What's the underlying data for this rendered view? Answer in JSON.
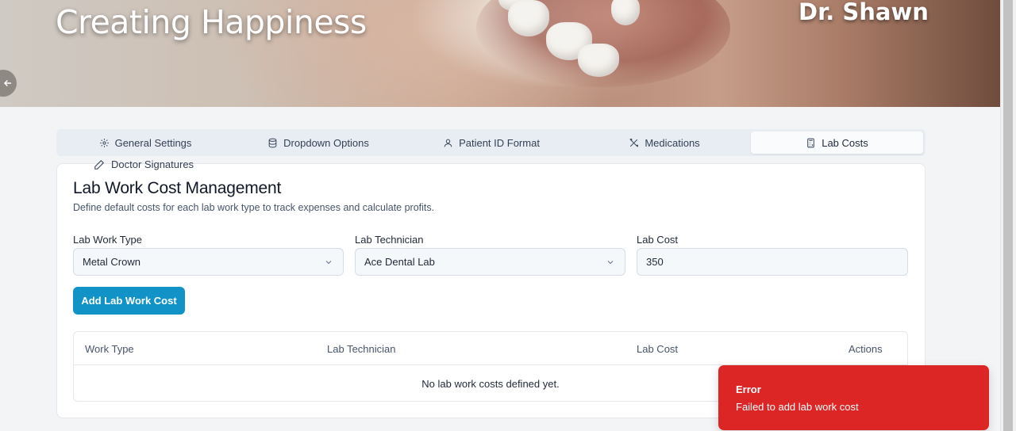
{
  "hero": {
    "title": "Creating Happiness",
    "doctor": "Dr. Shawn"
  },
  "tabs": [
    {
      "label": "General Settings",
      "icon": "gear-icon"
    },
    {
      "label": "Dropdown Options",
      "icon": "database-icon"
    },
    {
      "label": "Patient ID Format",
      "icon": "user-icon"
    },
    {
      "label": "Medications",
      "icon": "tools-icon"
    },
    {
      "label": "Lab Costs",
      "icon": "calculator-icon",
      "active": true
    },
    {
      "label": "Doctor Signatures",
      "icon": "pen-icon"
    }
  ],
  "card": {
    "title": "Lab Work Cost Management",
    "description": "Define default costs for each lab work type to track expenses and calculate profits."
  },
  "form": {
    "work_type_label": "Lab Work Type",
    "work_type_value": "Metal Crown",
    "technician_label": "Lab Technician",
    "technician_value": "Ace Dental Lab",
    "cost_label": "Lab Cost",
    "cost_value": "350",
    "add_button": "Add Lab Work Cost"
  },
  "table": {
    "columns": [
      "Work Type",
      "Lab Technician",
      "Lab Cost",
      "Actions"
    ],
    "empty_text": "No lab work costs defined yet."
  },
  "toast": {
    "title": "Error",
    "message": "Failed to add lab work cost",
    "color": "#dc2626"
  },
  "colors": {
    "primary": "#1193c7"
  }
}
